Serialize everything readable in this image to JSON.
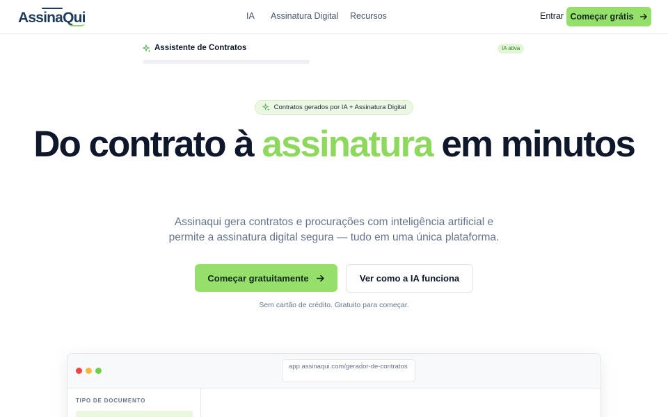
{
  "brand": {
    "name": "AssinaQui"
  },
  "nav": {
    "links": [
      "IA",
      "Assinatura Digital",
      "Recursos"
    ],
    "login_label": "Entrar",
    "cta_label": "Começar grátis"
  },
  "hero": {
    "pill_text": "Contratos gerados por IA + Assinatura Digital",
    "headline_pre": "Do contrato à ",
    "headline_highlight": "assinatura",
    "headline_post": " em minutos",
    "subtitle": "Assinaqui gera contratos e procurações com inteligência artificial e permite a assinatura digital segura — tudo em uma única plataforma.",
    "primary_cta": "Começar gratuitamente",
    "secondary_cta": "Ver como a IA funciona",
    "note": "Sem cartão de crédito. Gratuito para começar."
  },
  "app_preview": {
    "url": "app.assinaqui.com/gerador-de-contratos",
    "sidebar_label": "TIPO DE DOCUMENTO",
    "assistant_title": "Assistente de Contratos",
    "status_badge": "IA ativa"
  },
  "colors": {
    "accent": "#95e06b",
    "highlight_text": "#8fd85f",
    "text_dark": "#0f172a",
    "text_muted": "#64748b"
  },
  "icons": {
    "pill": "sparkles-icon",
    "cta": "arrow-right-icon",
    "assistant": "sparkles-icon"
  }
}
